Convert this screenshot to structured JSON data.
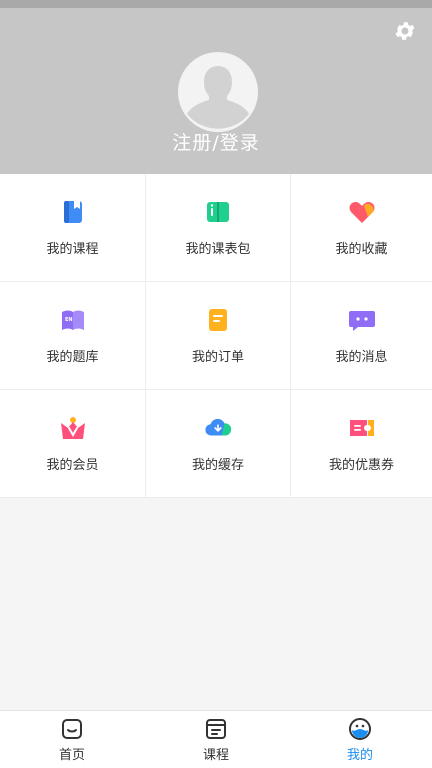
{
  "profile": {
    "login_label": "注册/登录",
    "settings_icon": "gear-icon",
    "avatar_icon": "user-silhouette-icon"
  },
  "menu": [
    {
      "label": "我的课程",
      "icon": "course-book-icon",
      "color": "#3f8cf5"
    },
    {
      "label": "我的课表包",
      "icon": "schedule-book-icon",
      "color": "#1ecf8e"
    },
    {
      "label": "我的收藏",
      "icon": "heart-icon",
      "color": "#ff5a6a"
    },
    {
      "label": "我的题库",
      "icon": "question-bank-icon",
      "color": "#8f6ef5"
    },
    {
      "label": "我的订单",
      "icon": "order-icon",
      "color": "#ffb21e"
    },
    {
      "label": "我的消息",
      "icon": "message-icon",
      "color": "#8f6ef5"
    },
    {
      "label": "我的会员",
      "icon": "vip-crown-icon",
      "color": "#ff4f7b"
    },
    {
      "label": "我的缓存",
      "icon": "cloud-download-icon",
      "color": "#3f8cf5"
    },
    {
      "label": "我的优惠券",
      "icon": "coupon-icon",
      "color": "#ff4f7b"
    }
  ],
  "tabbar": [
    {
      "label": "首页",
      "icon": "home-icon",
      "active": false
    },
    {
      "label": "课程",
      "icon": "course-icon",
      "active": false
    },
    {
      "label": "我的",
      "icon": "mine-icon",
      "active": true
    }
  ],
  "colors": {
    "header_bg": "#c6c6c6",
    "active_tab": "#1a8ff0",
    "text": "#333333"
  }
}
